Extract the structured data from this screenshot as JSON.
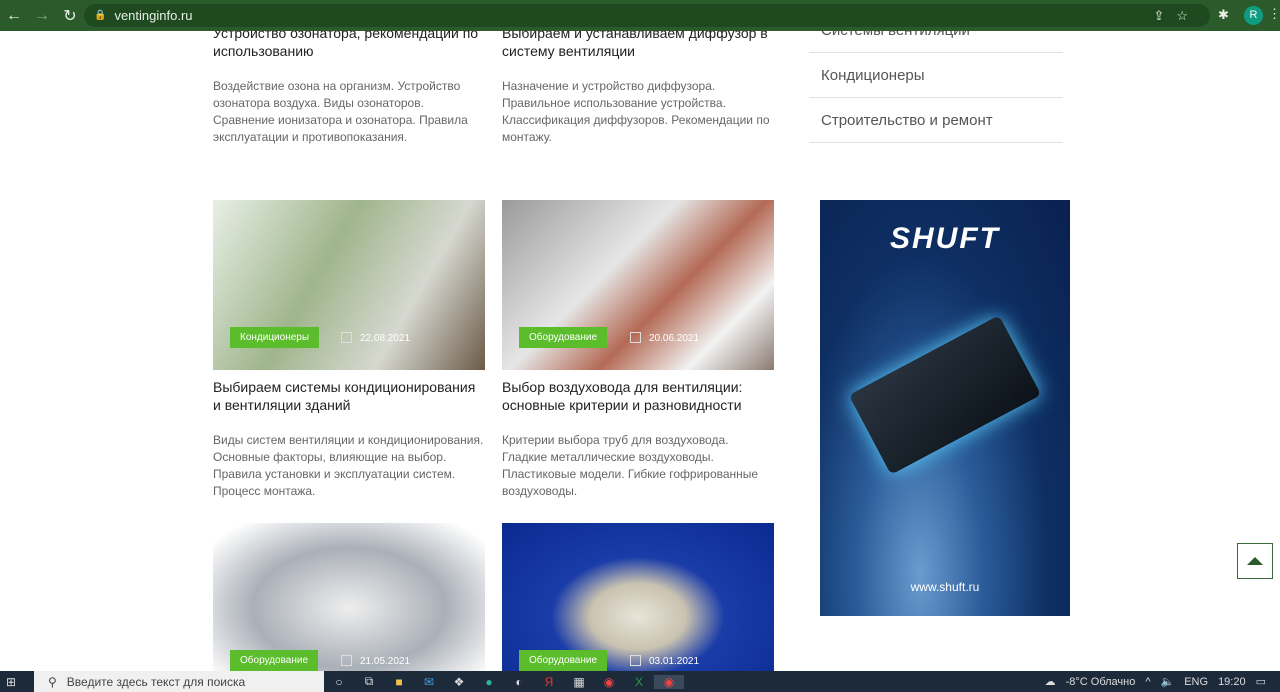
{
  "browser": {
    "url": "ventinginfo.ru",
    "profile_initial": "R"
  },
  "articles": [
    {
      "title": "Устройство озонатора, рекомендации по использованию",
      "desc": "Воздействие озона на организм. Устройство озонатора воздуха. Виды озонаторов. Сравнение ионизатора и озонатора. Правила эксплуатации и противопоказания."
    },
    {
      "title": "Выбираем и устанавливаем диффузор в систему вентиляции",
      "desc": "Назначение и устройство диффузора. Правильное использование устройства. Классификация диффузоров. Рекомендации по монтажу."
    },
    {
      "category": "Кондиционеры",
      "date": "22.08.2021",
      "title": "Выбираем системы кондиционирования и вентиляции зданий",
      "desc": "Виды систем вентиляции и кондиционирования. Основные факторы, влияющие на выбор. Правила установки и эксплуатации систем. Процесс монтажа."
    },
    {
      "category": "Оборудование",
      "date": "20.06.2021",
      "title": "Выбор воздуховода для вентиляции: основные критерии и разновидности",
      "desc": "Критерии выбора труб для воздуховода. Гладкие металлические воздуховоды. Пластиковые модели. Гибкие гофрированные воздуховоды."
    },
    {
      "category": "Оборудование",
      "date": "21.05.2021"
    },
    {
      "category": "Оборудование",
      "date": "03.01.2021"
    }
  ],
  "sidebar": {
    "categories": [
      "Системы вентиляции",
      "Кондиционеры",
      "Строительство и ремонт"
    ]
  },
  "ad": {
    "logo": "SHUFT",
    "site": "www.shuft.ru"
  },
  "taskbar": {
    "search_placeholder": "Введите здесь текст для поиска",
    "weather": "-8°C Облачно",
    "lang": "ENG",
    "time": "19:20"
  }
}
